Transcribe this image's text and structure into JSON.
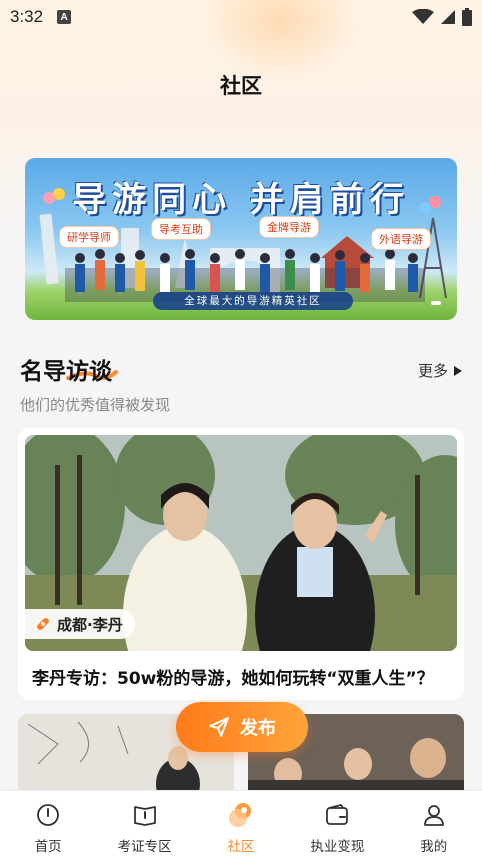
{
  "status_bar": {
    "time": "3:32",
    "notification_letter": "A"
  },
  "header": {
    "title": "社区"
  },
  "banner": {
    "slogan": "导游同心 并肩前行",
    "tags": [
      "研学导师",
      "导考互助",
      "金牌导游",
      "外语导游"
    ],
    "caption": "全球最大的导游精英社区"
  },
  "section": {
    "title": "名导访谈",
    "more": "更多",
    "subtitle": "他们的优秀值得被发现"
  },
  "feature_card": {
    "location": "成都·李丹",
    "title": "李丹专访：50w粉的导游，她如何玩转“双重人生”？"
  },
  "publish_button": {
    "label": "发布"
  },
  "tabbar": {
    "items": [
      {
        "label": "首页",
        "icon": "home-icon"
      },
      {
        "label": "考证专区",
        "icon": "book-icon"
      },
      {
        "label": "社区",
        "icon": "community-icon",
        "active": true
      },
      {
        "label": "执业变现",
        "icon": "wallet-icon"
      },
      {
        "label": "我的",
        "icon": "profile-icon"
      }
    ]
  },
  "colors": {
    "accent": "#ff8a2a",
    "active_tab": "#ff8a2a",
    "publish_gradient_start": "#ff7a1a",
    "publish_gradient_end": "#ffa53a"
  }
}
